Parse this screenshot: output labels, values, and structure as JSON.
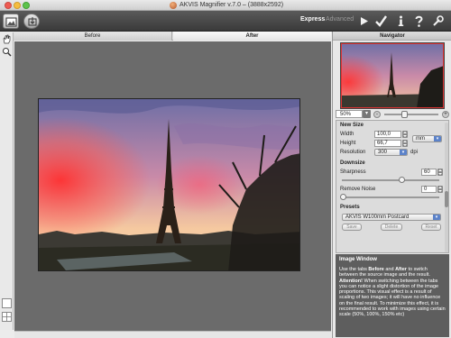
{
  "window": {
    "title": "AKVIS Magnifier v.7.0 –  (3888x2592)"
  },
  "toolbar": {
    "mode_express": "Express",
    "mode_advanced": "Advanced",
    "icons": [
      "open-image-icon",
      "save-image-icon",
      "run-icon",
      "apply-icon",
      "info-icon",
      "help-icon",
      "preferences-icon"
    ]
  },
  "tabs": {
    "before": "Before",
    "after": "After",
    "active": "After"
  },
  "navigator": {
    "title": "Navigator",
    "zoom": "50%"
  },
  "new_size": {
    "title": "New Size",
    "width_label": "Width",
    "width_value": "100,0",
    "height_label": "Height",
    "height_value": "66,7",
    "unit": "mm",
    "resolution_label": "Resolution",
    "resolution_value": "300",
    "resolution_unit": "dpi"
  },
  "downsize": {
    "title": "Downsize",
    "sharpness_label": "Sharpness",
    "sharpness_value": "60",
    "noise_label": "Remove Noise",
    "noise_value": "0"
  },
  "presets": {
    "title": "Presets",
    "selected": "AKVIS W100mm Postcard",
    "save_label": "Save",
    "delete_label": "Delete",
    "reset_label": "Reset"
  },
  "help": {
    "title": "Image Window",
    "text_1": "Use the tabs ",
    "before_word": "Before",
    "text_2": " and ",
    "after_word": "After",
    "text_3": " to switch between the source image and the result. ",
    "attention": "Attention!",
    "text_4": " When switching between the tabs you can notice a slight distortion of the image proportions. This visual effect is a result of scaling of two images; it will have no influence on the final result. To minimize this effect, it is recommended to work with images using certain scale (50%, 100%, 150% etc)"
  }
}
